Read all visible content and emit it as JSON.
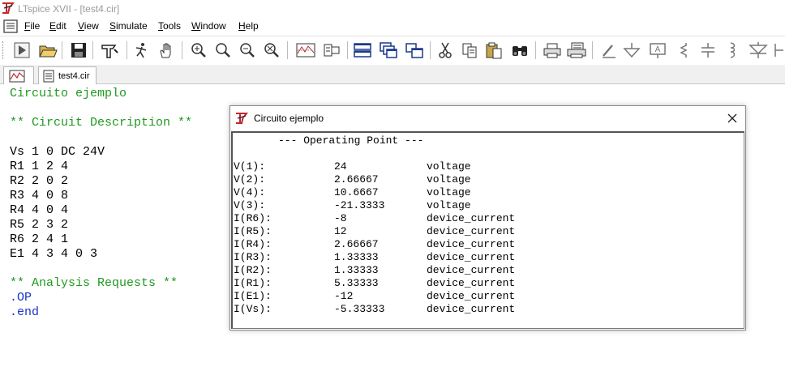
{
  "window": {
    "title": "LTspice XVII - [test4.cir]"
  },
  "menu": {
    "items": [
      {
        "label": "File",
        "ul": "F",
        "rest": "ile"
      },
      {
        "label": "Edit",
        "ul": "E",
        "rest": "dit"
      },
      {
        "label": "View",
        "ul": "V",
        "rest": "iew"
      },
      {
        "label": "Simulate",
        "ul": "S",
        "rest": "imulate"
      },
      {
        "label": "Tools",
        "ul": "T",
        "rest": "ools"
      },
      {
        "label": "Window",
        "ul": "W",
        "rest": "indow"
      },
      {
        "label": "Help",
        "ul": "H",
        "rest": "elp"
      }
    ]
  },
  "tabs": [
    {
      "label": ""
    },
    {
      "label": "test4.cir"
    }
  ],
  "netlist": {
    "lines": [
      "Circuito ejemplo",
      "",
      "** Circuit Description **",
      "",
      "Vs 1 0 DC 24V",
      "R1 1 2 4",
      "R2 2 0 2",
      "R3 4 0 8",
      "R4 4 0 4",
      "R5 2 3 2",
      "R6 2 4 1",
      "E1 4 3 4 0 3",
      "",
      "** Analysis Requests **",
      ".OP",
      ".end"
    ]
  },
  "dialog": {
    "title": "Circuito ejemplo",
    "header": "--- Operating Point ---",
    "rows": [
      {
        "name": "V(1):",
        "value": "24",
        "type": "voltage"
      },
      {
        "name": "V(2):",
        "value": "2.66667",
        "type": "voltage"
      },
      {
        "name": "V(4):",
        "value": "10.6667",
        "type": "voltage"
      },
      {
        "name": "V(3):",
        "value": "-21.3333",
        "type": "voltage"
      },
      {
        "name": "I(R6):",
        "value": "-8",
        "type": "device_current"
      },
      {
        "name": "I(R5):",
        "value": "12",
        "type": "device_current"
      },
      {
        "name": "I(R4):",
        "value": "2.66667",
        "type": "device_current"
      },
      {
        "name": "I(R3):",
        "value": "1.33333",
        "type": "device_current"
      },
      {
        "name": "I(R2):",
        "value": "1.33333",
        "type": "device_current"
      },
      {
        "name": "I(R1):",
        "value": "5.33333",
        "type": "device_current"
      },
      {
        "name": "I(E1):",
        "value": "-12",
        "type": "device_current"
      },
      {
        "name": "I(Vs):",
        "value": "-5.33333",
        "type": "device_current"
      }
    ]
  },
  "colors": {
    "comment": "#1f9a1f",
    "command": "#1a33c8",
    "logo_red": "#c0282d"
  },
  "toolbar": {
    "icons": [
      "run-icon",
      "open-icon",
      "save-icon",
      "control-panel-icon",
      "halt-icon",
      "pan-icon",
      "zoom-in-icon",
      "zoom-out-icon",
      "zoom-fit-icon",
      "autorange-icon",
      "view-window-icon",
      "tile-horizontal-icon",
      "cascade-icon",
      "tile-vertical-icon",
      "cut-icon",
      "copy-icon",
      "paste-icon",
      "find-icon",
      "print-preview-icon",
      "print-icon",
      "wire-icon",
      "ground-icon",
      "label-icon",
      "resistor-icon",
      "capacitor-icon",
      "inductor-icon",
      "diode-icon"
    ]
  }
}
